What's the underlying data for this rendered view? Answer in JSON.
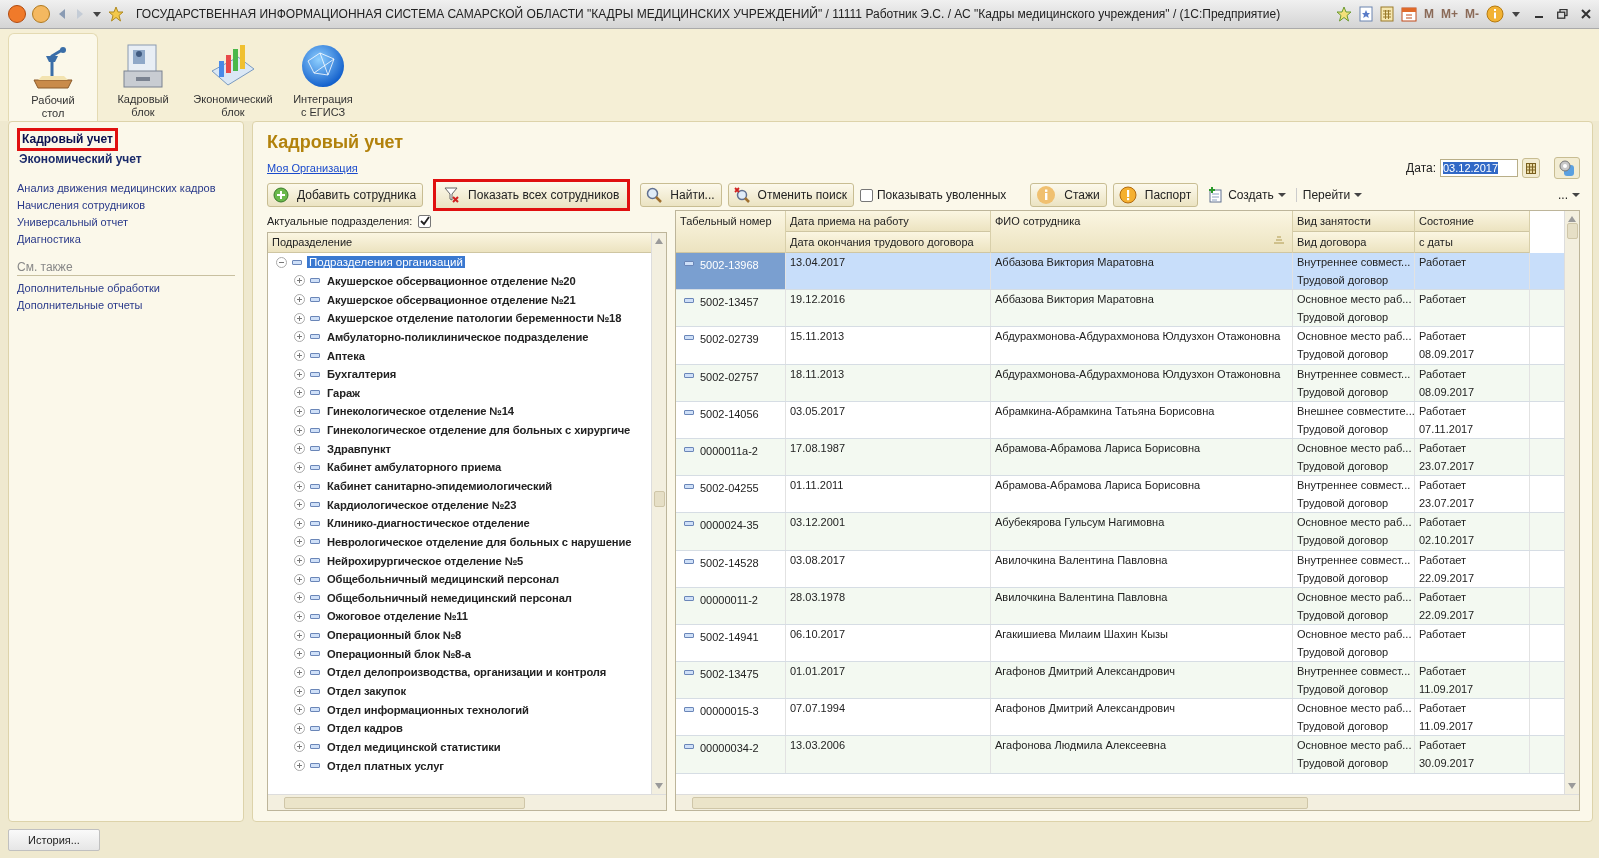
{
  "window": {
    "title": "ГОСУДАРСТВЕННАЯ ИНФОРМАЦИОННАЯ СИСТЕМА САМАРСКОЙ ОБЛАСТИ \"КАДРЫ МЕДИЦИНСКИХ УЧРЕЖДЕНИЙ\" / 11111 Работник Э.С. /  АС \"Кадры медицинского учреждения\" /  (1С:Предприятие)",
    "memory_buttons": [
      "M",
      "M+",
      "M-"
    ]
  },
  "sections": [
    {
      "label": "Рабочий\nстол",
      "selected": true
    },
    {
      "label": "Кадровый\nблок",
      "selected": false
    },
    {
      "label": "Экономический\nблок",
      "selected": false
    },
    {
      "label": "Интеграция\nс ЕГИСЗ",
      "selected": false
    }
  ],
  "sidebar": {
    "items": [
      {
        "kind": "section",
        "label": "Кадровый учет",
        "selected": true,
        "highlighted": true
      },
      {
        "kind": "section",
        "label": "Экономический учет",
        "selected": false,
        "highlighted": false
      },
      {
        "kind": "gap"
      },
      {
        "kind": "link",
        "label": "Анализ движения медицинских кадров"
      },
      {
        "kind": "link",
        "label": "Начисления сотрудников"
      },
      {
        "kind": "link",
        "label": "Универсальный отчет"
      },
      {
        "kind": "link",
        "label": "Диагностика"
      },
      {
        "kind": "header",
        "label": "См. также"
      },
      {
        "kind": "link",
        "label": "Дополнительные обработки"
      },
      {
        "kind": "link",
        "label": "Дополнительные отчеты"
      }
    ]
  },
  "page": {
    "title": "Кадровый учет",
    "organization_link": "Моя Организация",
    "date_label": "Дата:",
    "date_value": "03.12.2017"
  },
  "toolbar": [
    {
      "kind": "button",
      "label": "Добавить сотрудника",
      "highlighted": false
    },
    {
      "kind": "button",
      "label": "Показать всех сотрудников",
      "highlighted": true
    },
    {
      "kind": "button",
      "label": "Найти...",
      "highlighted": false
    },
    {
      "kind": "button",
      "label": "Отменить поиск",
      "highlighted": false
    },
    {
      "kind": "checkbox",
      "label": "Показывать уволенных",
      "checked": false
    },
    {
      "kind": "button",
      "label": "Стажи",
      "highlighted": false
    },
    {
      "kind": "button",
      "label": "Паспорт",
      "highlighted": false
    },
    {
      "kind": "menu",
      "label": "Создать"
    },
    {
      "kind": "menu",
      "label": "Перейти"
    },
    {
      "kind": "more",
      "label": "..."
    }
  ],
  "actual_filter": {
    "label": "Актуальные подразделения:",
    "checked": true
  },
  "tree": {
    "header": "Подразделение",
    "root": {
      "label": "Подразделения организаций",
      "expanded": true,
      "selected": true,
      "children": [
        {
          "label": "Акушерское обсервационное отделение №20",
          "expanded": false
        },
        {
          "label": "Акушерское обсервационное отделение №21",
          "expanded": false
        },
        {
          "label": "Акушерское отделение патологии беременности №18",
          "expanded": false
        },
        {
          "label": "Амбулаторно-поликлиническое подразделение",
          "expanded": false
        },
        {
          "label": "Аптека",
          "expanded": false
        },
        {
          "label": "Бухгалтерия",
          "expanded": false
        },
        {
          "label": "Гараж",
          "expanded": false
        },
        {
          "label": "Гинекологическое отделение №14",
          "expanded": false
        },
        {
          "label": "Гинекологическое отделение для больных с хирургиче",
          "expanded": false
        },
        {
          "label": "Здравпункт",
          "expanded": false
        },
        {
          "label": "Кабинет амбулаторного приема",
          "expanded": false
        },
        {
          "label": "Кабинет санитарно-эпидемиологический",
          "expanded": false
        },
        {
          "label": "Кардиологическое отделение №23",
          "expanded": false
        },
        {
          "label": "Клинико-диагностическое отделение",
          "expanded": false
        },
        {
          "label": "Неврологическое отделение для больных с нарушение",
          "expanded": false
        },
        {
          "label": "Нейрохирургическое отделение №5",
          "expanded": false
        },
        {
          "label": "Общебольничный медицинский персонал",
          "expanded": false
        },
        {
          "label": "Общебольничный немедицинский персонал",
          "expanded": false
        },
        {
          "label": "Ожоговое отделение №11",
          "expanded": false
        },
        {
          "label": "Операционный блок №8",
          "expanded": false
        },
        {
          "label": "Операционный блок №8-а",
          "expanded": false
        },
        {
          "label": "Отдел делопроизводства, организации и контроля",
          "expanded": false
        },
        {
          "label": "Отдел закупок",
          "expanded": false
        },
        {
          "label": "Отдел информационных технологий",
          "expanded": false
        },
        {
          "label": "Отдел кадров",
          "expanded": false
        },
        {
          "label": "Отдел медицинской статистики",
          "expanded": false
        },
        {
          "label": "Отдел платных услуг",
          "expanded": false
        }
      ]
    }
  },
  "table": {
    "columns": [
      {
        "top": "Табельный номер"
      },
      {
        "top": "Дата приема на работу",
        "bottom": "Дата окончания трудового договора"
      },
      {
        "top": "ФИО сотрудника"
      },
      {
        "top": "Вид занятости",
        "bottom": "Вид договора"
      },
      {
        "top": "Состояние",
        "bottom": "с даты"
      }
    ],
    "rows": [
      {
        "number": "5002-13968",
        "hired": "13.04.2017",
        "name": "Аббазова Виктория Маратовна",
        "employment": "Внутреннее совмест...",
        "contract": "Трудовой договор",
        "status": "Работает",
        "selected": true
      },
      {
        "number": "5002-13457",
        "hired": "19.12.2016",
        "name": "Аббазова Виктория Маратовна",
        "employment": "Основное место раб...",
        "contract": "Трудовой договор",
        "status": "Работает",
        "selected": false
      },
      {
        "number": "5002-02739",
        "hired": "15.11.2013",
        "name": "Абдурахмонова-Абдурахмонова Юлдузхон Отажоновна",
        "employment": "Основное место раб...",
        "contract": "Трудовой договор",
        "status": "Работает",
        "since": "08.09.2017",
        "selected": false
      },
      {
        "number": "5002-02757",
        "hired": "18.11.2013",
        "name": "Абдурахмонова-Абдурахмонова Юлдузхон Отажоновна",
        "employment": "Внутреннее совмест...",
        "contract": "Трудовой договор",
        "status": "Работает",
        "since": "08.09.2017",
        "selected": false
      },
      {
        "number": "5002-14056",
        "hired": "03.05.2017",
        "name": "Абрамкина-Абрамкина Татьяна Борисовна",
        "employment": "Внешнее совместите...",
        "contract": "Трудовой договор",
        "status": "Работает",
        "since": "07.11.2017",
        "selected": false
      },
      {
        "number": "0000011a-2",
        "hired": "17.08.1987",
        "name": "Абрамова-Абрамова Лариса Борисовна",
        "employment": "Основное место раб...",
        "contract": "Трудовой договор",
        "status": "Работает",
        "since": "23.07.2017",
        "selected": false
      },
      {
        "number": "5002-04255",
        "hired": "01.11.2011",
        "name": "Абрамова-Абрамова Лариса Борисовна",
        "employment": "Внутреннее совмест...",
        "contract": "Трудовой договор",
        "status": "Работает",
        "since": "23.07.2017",
        "selected": false
      },
      {
        "number": "0000024-35",
        "hired": "03.12.2001",
        "name": "Абубекярова Гульсум Нагимовна",
        "employment": "Основное место раб...",
        "contract": "Трудовой договор",
        "status": "Работает",
        "since": "02.10.2017",
        "selected": false
      },
      {
        "number": "5002-14528",
        "hired": "03.08.2017",
        "name": "Авилочкина Валентина Павловна",
        "employment": "Внутреннее совмест...",
        "contract": "Трудовой договор",
        "status": "Работает",
        "since": "22.09.2017",
        "selected": false
      },
      {
        "number": "00000011-2",
        "hired": "28.03.1978",
        "name": "Авилочкина Валентина Павловна",
        "employment": "Основное место раб...",
        "contract": "Трудовой договор",
        "status": "Работает",
        "since": "22.09.2017",
        "selected": false
      },
      {
        "number": "5002-14941",
        "hired": "06.10.2017",
        "name": "Агакишиева Милаим Шахин Кызы",
        "employment": "Основное место раб...",
        "contract": "Трудовой договор",
        "status": "Работает",
        "selected": false
      },
      {
        "number": "5002-13475",
        "hired": "01.01.2017",
        "name": "Агафонов Дмитрий Александрович",
        "employment": "Внутреннее совмест...",
        "contract": "Трудовой договор",
        "status": "Работает",
        "since": "11.09.2017",
        "selected": false
      },
      {
        "number": "00000015-3",
        "hired": "07.07.1994",
        "name": "Агафонов Дмитрий Александрович",
        "employment": "Основное место раб...",
        "contract": "Трудовой договор",
        "status": "Работает",
        "since": "11.09.2017",
        "selected": false
      },
      {
        "number": "00000034-2",
        "hired": "13.03.2006",
        "name": "Агафонова Людмила Алексеевна",
        "employment": "Основное место раб...",
        "contract": "Трудовой договор",
        "status": "Работает",
        "since": "30.09.2017",
        "selected": false
      }
    ]
  },
  "status_bar": {
    "history_button": "История..."
  }
}
